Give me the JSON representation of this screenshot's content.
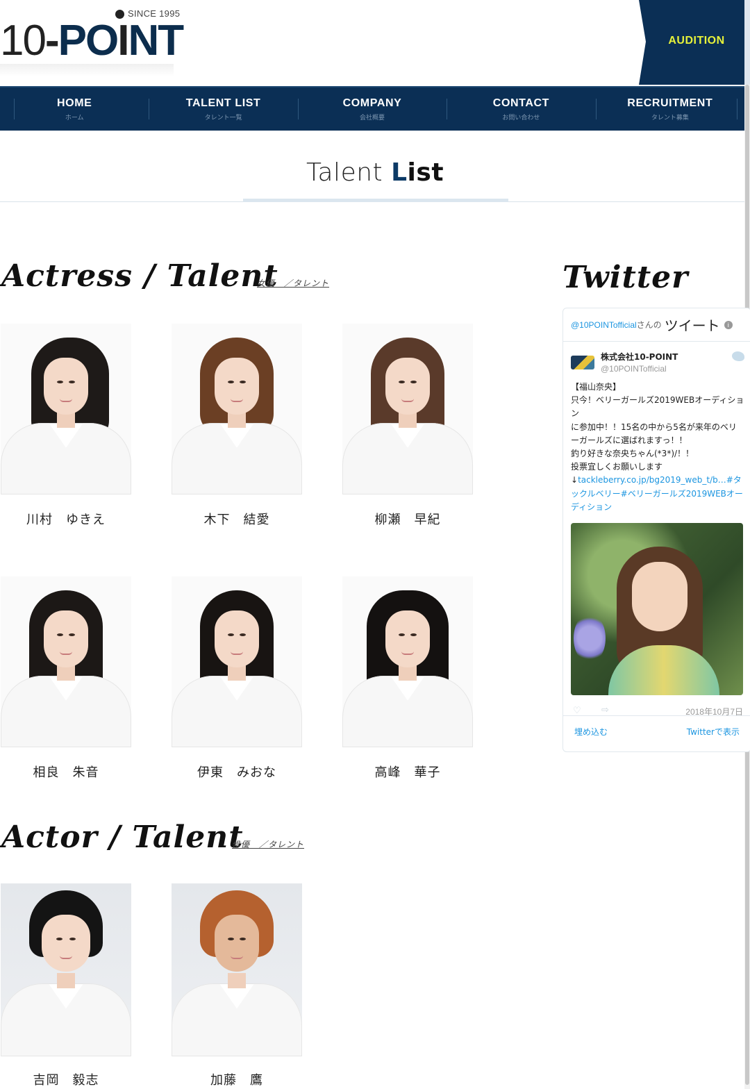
{
  "header": {
    "logo": {
      "since": "SINCE 1995",
      "num": "10",
      "dash": "-",
      "word_a": "PO",
      "word_i": "I",
      "word_b": "NT"
    },
    "audition_label": "AUDITION"
  },
  "nav": [
    {
      "label": "HOME",
      "sub": "ホーム"
    },
    {
      "label": "TALENT LIST",
      "sub": "タレント一覧"
    },
    {
      "label": "COMPANY",
      "sub": "会社概要"
    },
    {
      "label": "CONTACT",
      "sub": "お問い合わせ"
    },
    {
      "label": "RECRUITMENT",
      "sub": "タレント募集"
    }
  ],
  "page_title": {
    "light": "Talent ",
    "strong_first": "L",
    "strong_rest": "ist"
  },
  "actress": {
    "title": "Actress / Talent",
    "sub": "女優　／タレント",
    "talents": [
      {
        "name": "川村　ゆきえ"
      },
      {
        "name": "木下　結愛"
      },
      {
        "name": "柳瀬　早紀"
      },
      {
        "name": "相良　朱音"
      },
      {
        "name": "伊東　みおな"
      },
      {
        "name": "高峰　華子"
      }
    ]
  },
  "actor": {
    "title": "Actor / Talent",
    "sub": "俳優　／タレント",
    "talents": [
      {
        "name": "吉岡　毅志"
      },
      {
        "name": "加藤　鷹"
      }
    ]
  },
  "twitter": {
    "heading": "Twitter",
    "timeline_handle": "@10POINTofficial",
    "timeline_san": "さんの",
    "timeline_tweets": "ツイート",
    "account_name": "株式会社10-POINT",
    "account_handle": "@10POINTofficial",
    "tweet_lines": [
      "【福山奈央】",
      "只今！ベリーガールズ2019WEBオーディション",
      "に参加中！！15名の中から5名が来年のベリーガールズに選ばれますっ！！",
      "釣り好きな奈央ちゃん(*3*)/！！",
      "投票宜しくお願いします"
    ],
    "tweet_arrow": "↓",
    "tweet_link": "tackleberry.co.jp/bg2019_web_t/b…#タックルベリー#ベリーガールズ2019WEBオーディション",
    "date": "2018年10月7日",
    "embed_label": "埋め込む",
    "view_label": "Twitterで表示"
  },
  "colors": {
    "navy": "#0b2f55",
    "audition_text": "#e7f23a",
    "link": "#1b95e0"
  },
  "icons": [
    "info-icon",
    "bird-icon",
    "heart-icon",
    "share-icon"
  ]
}
